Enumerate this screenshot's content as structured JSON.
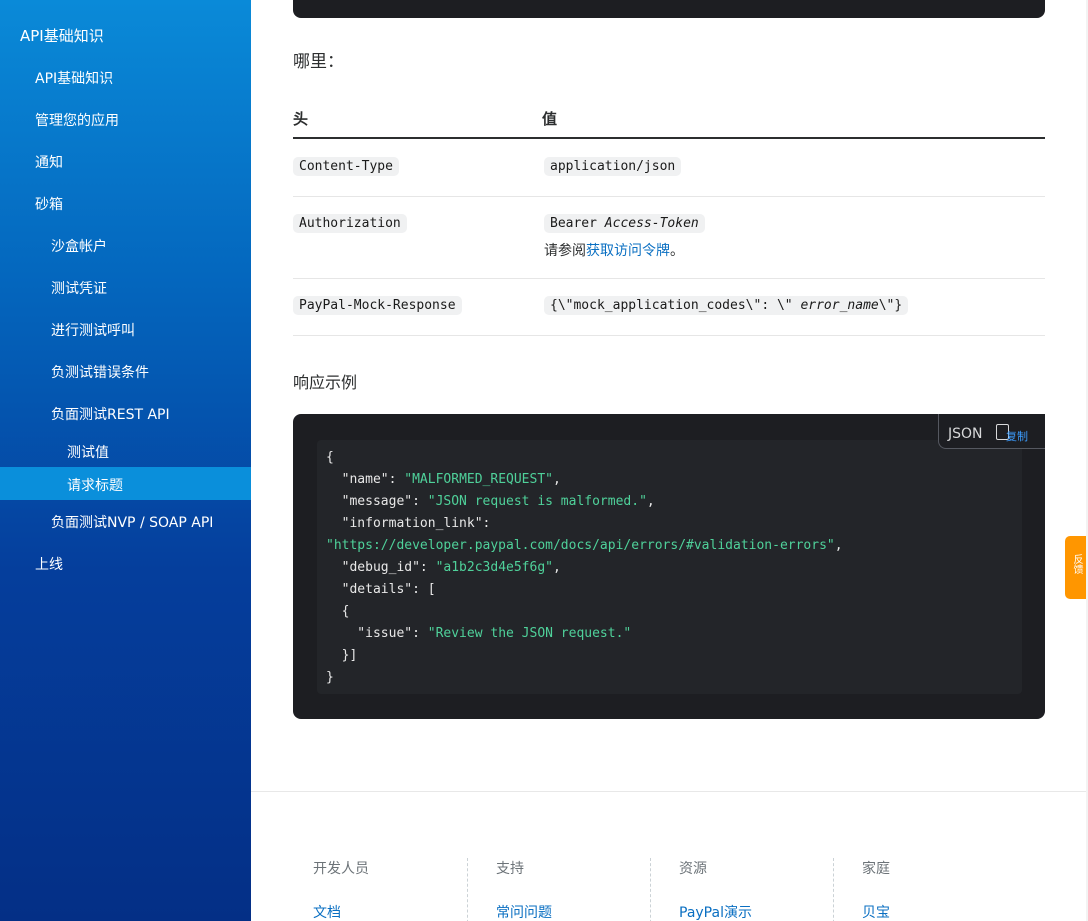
{
  "sidebar": {
    "items": [
      {
        "label": "API基础知识"
      },
      {
        "label": "API基础知识"
      },
      {
        "label": "管理您的应用"
      },
      {
        "label": "通知"
      },
      {
        "label": "砂箱"
      },
      {
        "label": "沙盒帐户"
      },
      {
        "label": "测试凭证"
      },
      {
        "label": "进行测试呼叫"
      },
      {
        "label": "负测试错误条件"
      },
      {
        "label": "负面测试REST API"
      },
      {
        "label": "测试值"
      },
      {
        "label": "请求标题"
      },
      {
        "label": "负面测试NVP / SOAP API"
      },
      {
        "label": "上线"
      }
    ]
  },
  "content": {
    "where_label": "哪里：",
    "table": {
      "headers": [
        "头",
        "值"
      ],
      "rows": [
        {
          "header": "Content-Type",
          "value": "application/json"
        },
        {
          "header": "Authorization",
          "value_prefix": "Bearer ",
          "value_italic": "Access-Token",
          "note_prefix": "请参阅",
          "note_link": "获取访问令牌",
          "note_suffix": "。"
        },
        {
          "header": "PayPal-Mock-Response",
          "value_prefix": "{\\\"mock_application_codes\\\": \\\" ",
          "value_italic": "error_name",
          "value_suffix": "\\\"}"
        }
      ]
    },
    "response_label": "响应示例",
    "code_tab": {
      "lang": "JSON",
      "copy": "复制"
    }
  },
  "colors": {
    "sidebar_top": "#0a8ad8",
    "sidebar_bottom": "#042f86",
    "sidebar_active": "#0a8fdb",
    "code_bg": "#1d1e22",
    "code_string": "#4fd19a",
    "link": "#0a6fc2",
    "feedback": "#ff9600"
  },
  "footer": {
    "columns": [
      {
        "head": "开发人员",
        "link": "文档"
      },
      {
        "head": "支持",
        "link": "常问问题"
      },
      {
        "head": "资源",
        "link": "PayPal演示"
      },
      {
        "head": "家庭",
        "link": "贝宝"
      }
    ]
  },
  "feedback": {
    "label": "反馈"
  },
  "icons": {
    "copy": "copy-icon"
  }
}
